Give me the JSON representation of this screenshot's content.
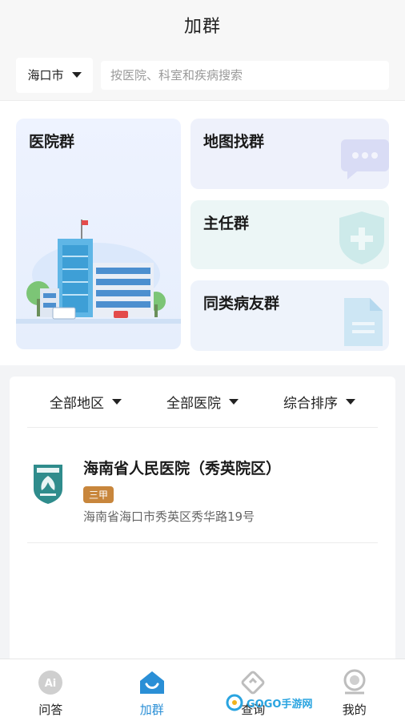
{
  "header": {
    "title": "加群"
  },
  "search": {
    "city": "海口市",
    "placeholder": "按医院、科室和疾病搜索"
  },
  "cards": {
    "hospital_group": "医院群",
    "map_group": "地图找群",
    "director_group": "主任群",
    "patient_group": "同类病友群"
  },
  "filters": {
    "region": "全部地区",
    "hospital": "全部医院",
    "sort": "综合排序"
  },
  "hospitals": [
    {
      "name": "海南省人民医院（秀英院区）",
      "grade": "三甲",
      "address": "海南省海口市秀英区秀华路19号"
    }
  ],
  "nav": {
    "items": [
      {
        "label": "问答",
        "icon": "ai-icon"
      },
      {
        "label": "加群",
        "icon": "group-icon"
      },
      {
        "label": "查询",
        "icon": "diamond-icon"
      },
      {
        "label": "我的",
        "icon": "user-icon"
      }
    ],
    "watermark": "GOGO手游网"
  },
  "colors": {
    "accent": "#2a8fd6",
    "badge": "#c8863c"
  }
}
